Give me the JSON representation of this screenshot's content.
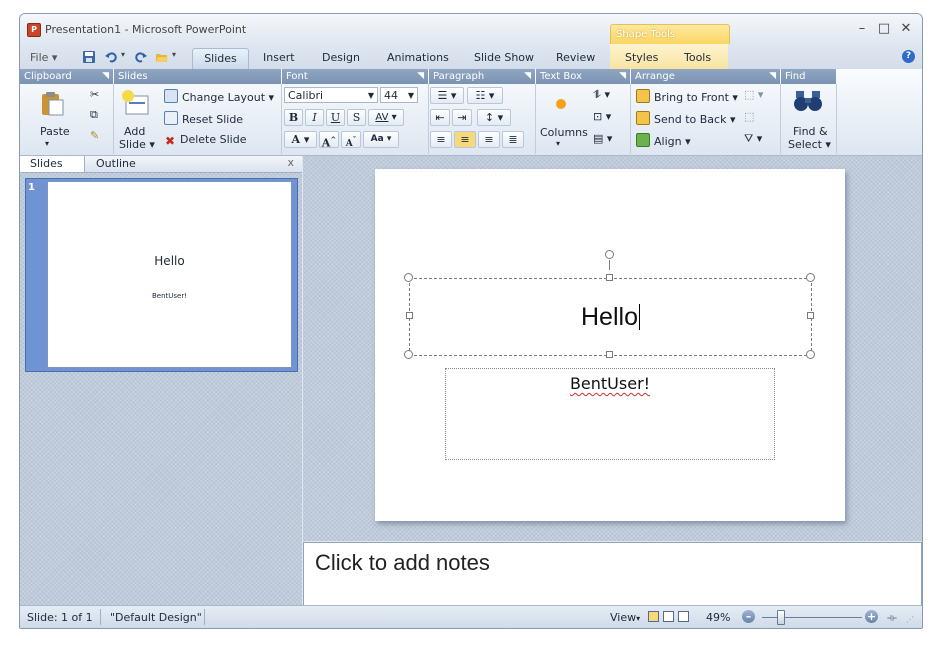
{
  "window": {
    "title": "Presentation1 - Microsoft PowerPoint",
    "context_group": "Shape Tools",
    "minimize": "–",
    "maximize": "□",
    "close": "✕"
  },
  "tabs": {
    "file": "File",
    "slides": "Slides",
    "insert": "Insert",
    "design": "Design",
    "animations": "Animations",
    "slideshow": "Slide Show",
    "review": "Review",
    "styles": "Styles",
    "tools": "Tools"
  },
  "ribbon": {
    "clipboard": {
      "header": "Clipboard",
      "paste": "Paste"
    },
    "slides": {
      "header": "Slides",
      "add_slide_1": "Add",
      "add_slide_2": "Slide",
      "change_layout": "Change Layout",
      "reset_slide": "Reset Slide",
      "delete_slide": "Delete Slide"
    },
    "font": {
      "header": "Font",
      "name": "Calibri",
      "size": "44",
      "bold": "B",
      "italic": "I",
      "underline": "U",
      "shadow": "S",
      "spacing": "AV",
      "color": "A",
      "grow": "A",
      "shrink": "A",
      "case": "Aa"
    },
    "paragraph": {
      "header": "Paragraph"
    },
    "textbox": {
      "header": "Text Box",
      "columns": "Columns"
    },
    "arrange": {
      "header": "Arrange",
      "bring_front": "Bring to Front",
      "send_back": "Send to Back",
      "align": "Align"
    },
    "find": {
      "header": "Find",
      "find_select_1": "Find &",
      "find_select_2": "Select"
    }
  },
  "left_panel": {
    "tab_slides": "Slides",
    "tab_outline": "Outline",
    "close": "x",
    "thumb_number": "1",
    "thumb_title": "Hello",
    "thumb_subtitle": "BentUser!"
  },
  "slide": {
    "title": "Hello",
    "subtitle": "BentUser!"
  },
  "notes": {
    "placeholder": "Click to add notes"
  },
  "status": {
    "slide": "Slide: 1 of 1",
    "design": "\"Default Design\"",
    "view": "View",
    "zoom": "49%"
  }
}
